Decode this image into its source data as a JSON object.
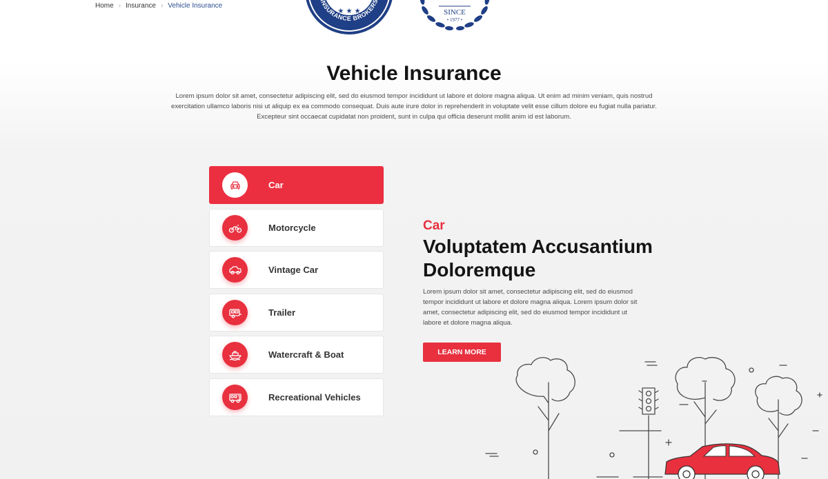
{
  "breadcrumb": {
    "items": [
      "Home",
      "Insurance"
    ],
    "current": "Vehicle Insurance"
  },
  "badges": {
    "seal1_text": "INSURANCE BROKERS",
    "seal2_since": "SINCE",
    "seal2_year": "• 1977 •"
  },
  "page": {
    "title": "Vehicle Insurance",
    "intro": "Lorem ipsum dolor sit amet, consectetur adipiscing elit, sed do eiusmod tempor incididunt ut labore et dolore magna aliqua. Ut enim ad minim veniam, quis nostrud exercitation ullamco laboris nisi ut aliquip ex ea commodo consequat. Duis aute irure dolor in reprehenderit in voluptate velit esse cillum dolore eu fugiat nulla pariatur. Excepteur sint occaecat cupidatat non proident, sunt in culpa qui officia deserunt mollit anim id est laborum."
  },
  "vehicles": [
    {
      "label": "Car",
      "icon": "car-icon",
      "active": true
    },
    {
      "label": "Motorcycle",
      "icon": "motorcycle-icon",
      "active": false
    },
    {
      "label": "Vintage Car",
      "icon": "vintage-car-icon",
      "active": false
    },
    {
      "label": "Trailer",
      "icon": "trailer-icon",
      "active": false
    },
    {
      "label": "Watercraft & Boat",
      "icon": "boat-icon",
      "active": false
    },
    {
      "label": "Recreational Vehicles",
      "icon": "rv-icon",
      "active": false
    }
  ],
  "detail": {
    "kicker": "Car",
    "title": "Voluptatem Accusantium Doloremque",
    "text": "Lorem ipsum dolor sit amet, consectetur adipiscing elit, sed do eiusmod tempor incididunt ut labore et dolore magna aliqua. Lorem ipsum dolor sit amet, consectetur adipiscing elit, sed do eiusmod tempor incididunt ut labore et dolore magna aliqua.",
    "button": "LEARN MORE"
  },
  "colors": {
    "accent": "#e8303f",
    "navy": "#1f3f86",
    "text_dark": "#141414",
    "text_body": "#4a4a4a"
  }
}
